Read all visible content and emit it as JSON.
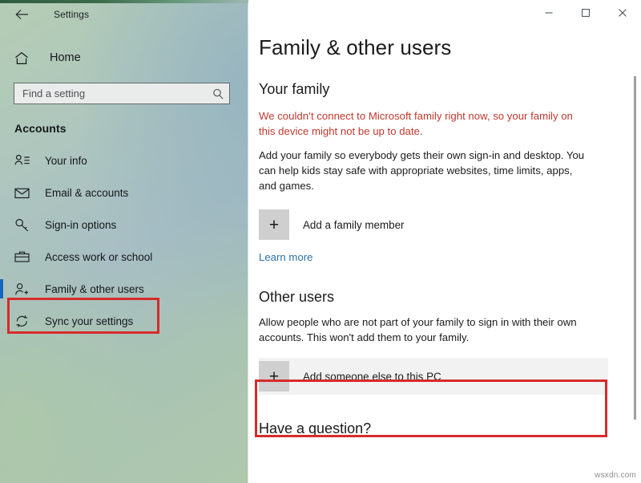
{
  "window": {
    "app_title": "Settings",
    "back_icon": "back-arrow-icon",
    "controls": {
      "minimize": "─",
      "maximize": "☐",
      "close": "✕"
    }
  },
  "sidebar": {
    "home_label": "Home",
    "home_icon": "home-icon",
    "search": {
      "placeholder": "Find a setting",
      "value": "",
      "icon": "search-icon"
    },
    "nav_title": "Accounts",
    "items": [
      {
        "label": "Your info",
        "icon": "user-info-icon",
        "selected": false
      },
      {
        "label": "Email & accounts",
        "icon": "envelope-icon",
        "selected": false
      },
      {
        "label": "Sign-in options",
        "icon": "key-icon",
        "selected": false
      },
      {
        "label": "Access work or school",
        "icon": "briefcase-icon",
        "selected": false
      },
      {
        "label": "Family & other users",
        "icon": "user-plus-icon",
        "selected": true
      },
      {
        "label": "Sync your settings",
        "icon": "sync-icon",
        "selected": false
      }
    ]
  },
  "main": {
    "page_title": "Family & other users",
    "your_family": {
      "heading": "Your family",
      "error": "We couldn’t connect to Microsoft family right now, so your family on this device might not be up to date.",
      "description": "Add your family so everybody gets their own sign-in and desktop. You can help kids stay safe with appropriate websites, time limits, apps, and games.",
      "add_button": "Add a family member",
      "plus_glyph": "+",
      "learn_more": "Learn more"
    },
    "other_users": {
      "heading": "Other users",
      "description": "Allow people who are not part of your family to sign in with their own accounts. This won't add them to your family.",
      "add_button": "Add someone else to this PC",
      "plus_glyph": "+"
    },
    "question_heading": "Have a question?"
  },
  "annotations": {
    "highlight_color": "#d72b2b"
  },
  "watermark": "wsxdn.com"
}
